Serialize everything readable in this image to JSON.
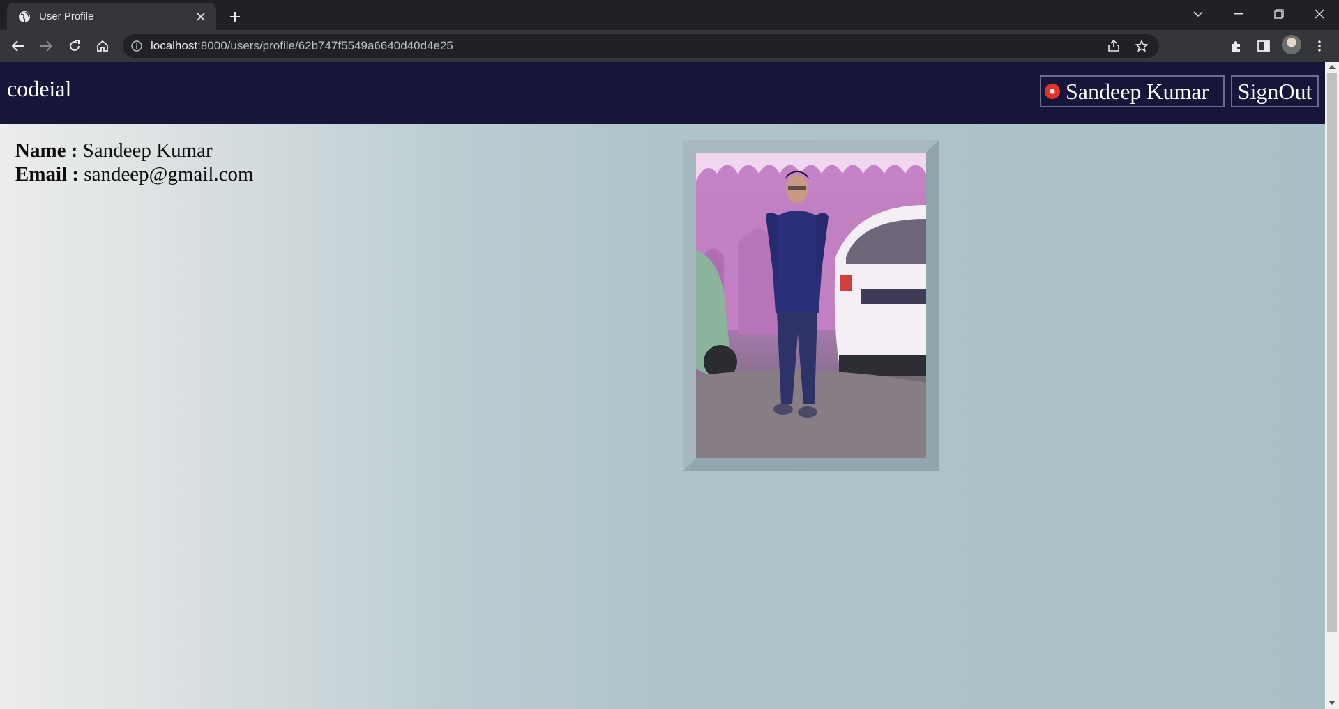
{
  "browser": {
    "tab_title": "User Profile",
    "url_host": "localhost",
    "url_path": ":8000/users/profile/62b747f5549a6640d40d4e25"
  },
  "site": {
    "brand": "codeial",
    "user_button_label": "Sandeep Kumar",
    "signout_label": "SignOut"
  },
  "profile": {
    "name_label": "Name :",
    "name_value": "Sandeep Kumar",
    "email_label": "Email :",
    "email_value": "sandeep@gmail.com",
    "photo_icon": "profile-photo"
  },
  "colors": {
    "navbar": "#15163a",
    "page_gradient_start": "#ecedec",
    "page_gradient_end": "#a9c1c6",
    "frame": "#98adb4"
  }
}
